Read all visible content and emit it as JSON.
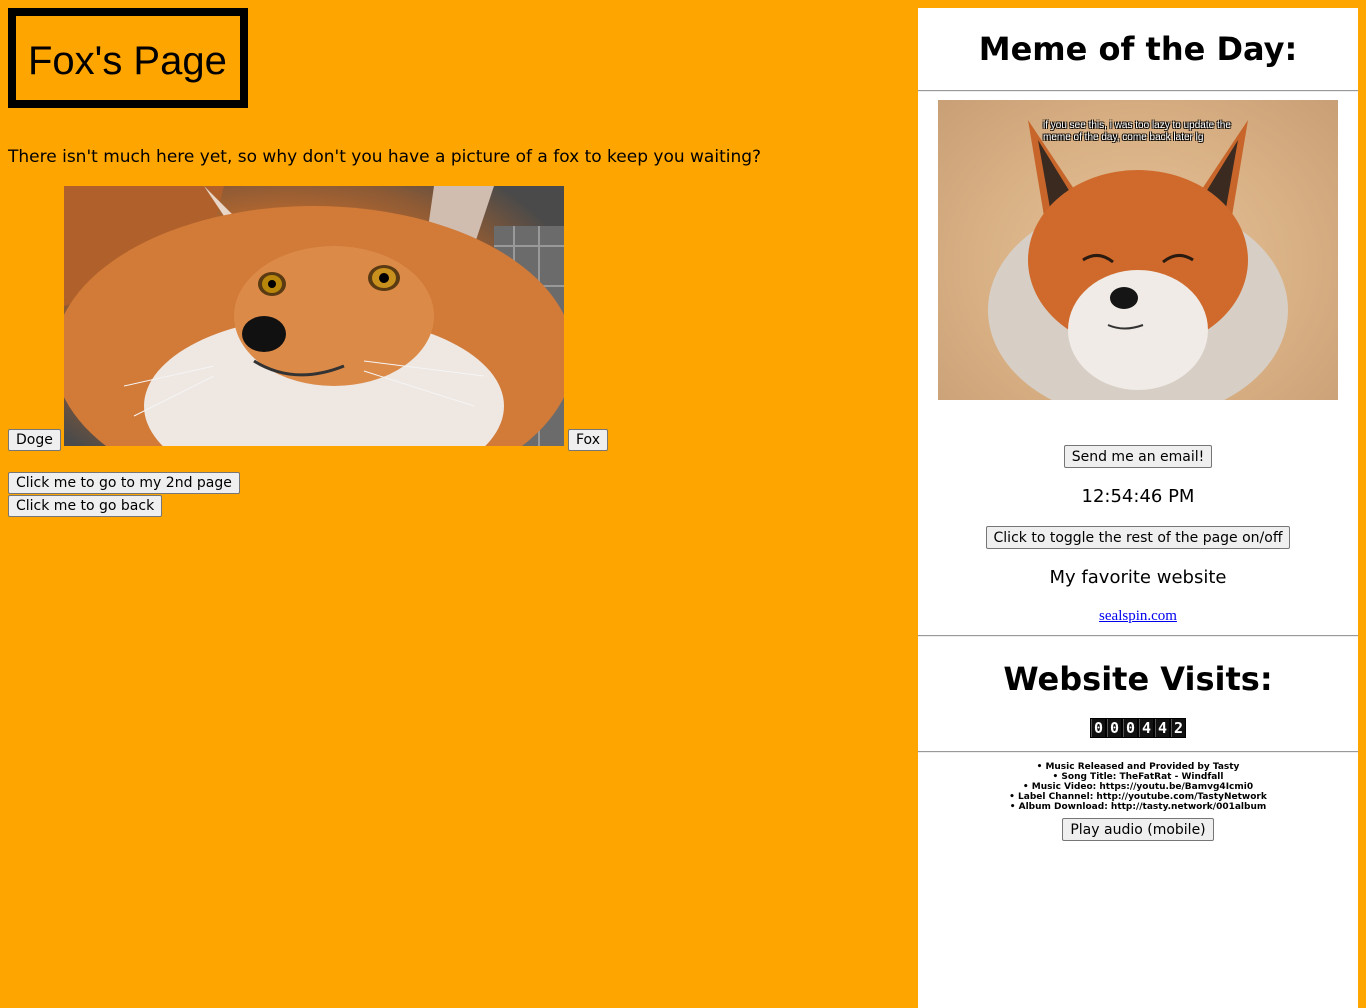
{
  "main": {
    "title": "Fox's Page",
    "intro": "There isn't much here yet, so why don't you have a picture of a fox to keep you waiting?",
    "doge_button": "Doge",
    "fox_button": "Fox",
    "second_page_button": "Click me to go to my 2nd page",
    "go_back_button": "Click me to go back"
  },
  "sidebar": {
    "meme_heading": "Meme of the Day:",
    "meme_caption": "if you see this, i was too lazy to update the meme of the day, come back later lg",
    "email_button": "Send me an email!",
    "clock": "12:54:46 PM",
    "toggle_button": "Click to toggle the rest of the page on/off",
    "favorite_label": "My favorite website",
    "favorite_link": "sealspin.com",
    "visits_heading": "Website Visits:",
    "visit_digits": [
      "0",
      "0",
      "0",
      "4",
      "4",
      "2"
    ],
    "credits": [
      "• Music Released and Provided by Tasty",
      "• Song Title: TheFatRat - Windfall",
      "• Music Video: https://youtu.be/Bamvg4Icmi0",
      "• Label Channel: http://youtube.com/TastyNetwork",
      "• Album Download: http://tasty.network/001album"
    ],
    "play_audio_button": "Play audio (mobile)"
  },
  "colors": {
    "page_background": "#ffa500",
    "sidebar_background": "#ffffff",
    "link": "#0000ee"
  }
}
